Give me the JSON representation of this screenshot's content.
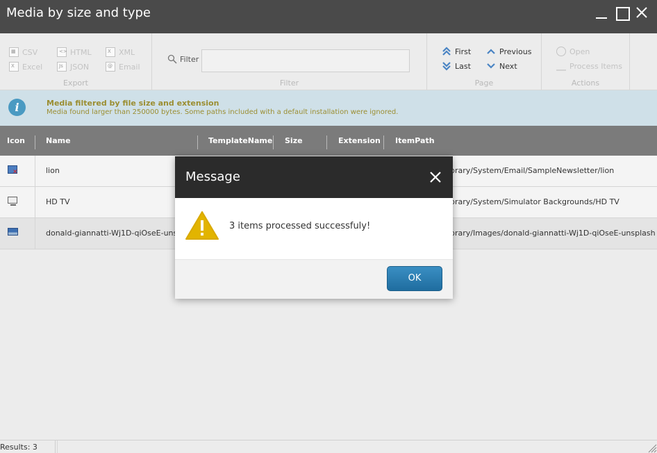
{
  "window": {
    "title": "Media by size and type"
  },
  "ribbon": {
    "export": {
      "label": "Export",
      "csv": "CSV",
      "excel": "Excel",
      "html": "HTML",
      "json": "JSON",
      "xml": "XML",
      "email": "Email"
    },
    "filter": {
      "group_label": "Filter",
      "label": "Filter",
      "value": ""
    },
    "page": {
      "label": "Page",
      "first": "First",
      "last": "Last",
      "previous": "Previous",
      "next": "Next"
    },
    "actions": {
      "label": "Actions",
      "open": "Open",
      "process_items": "Process Items"
    }
  },
  "info": {
    "title": "Media filtered by file size and extension",
    "message": "Media found larger than 250000 bytes. Some paths included with a default installation were ignored."
  },
  "grid": {
    "columns": [
      "Icon",
      "Name",
      "TemplateName",
      "Size",
      "Extension",
      "ItemPath"
    ],
    "rows": [
      {
        "name": "lion",
        "itempath": "brary/System/Email/SampleNewsletter/lion"
      },
      {
        "name": "HD TV",
        "itempath": "brary/System/Simulator Backgrounds/HD TV"
      },
      {
        "name": "donald-giannatti-Wj1D-qiOseE-unsplash",
        "itempath": "brary/Images/donald-giannatti-Wj1D-qiOseE-unsplash"
      }
    ]
  },
  "status": {
    "results": "Results: 3"
  },
  "dialog": {
    "title": "Message",
    "message": "3 items processed successfuly!",
    "ok": "OK"
  },
  "colors": {
    "titlebar": "#4a4a4a",
    "grid_header": "#7b7b7b",
    "info_bg": "#cfe0e8",
    "info_text": "#9b8e32",
    "dialog_header": "#2b2b2b",
    "ok_button": "#2a7fb5",
    "warning": "#e2b400"
  }
}
